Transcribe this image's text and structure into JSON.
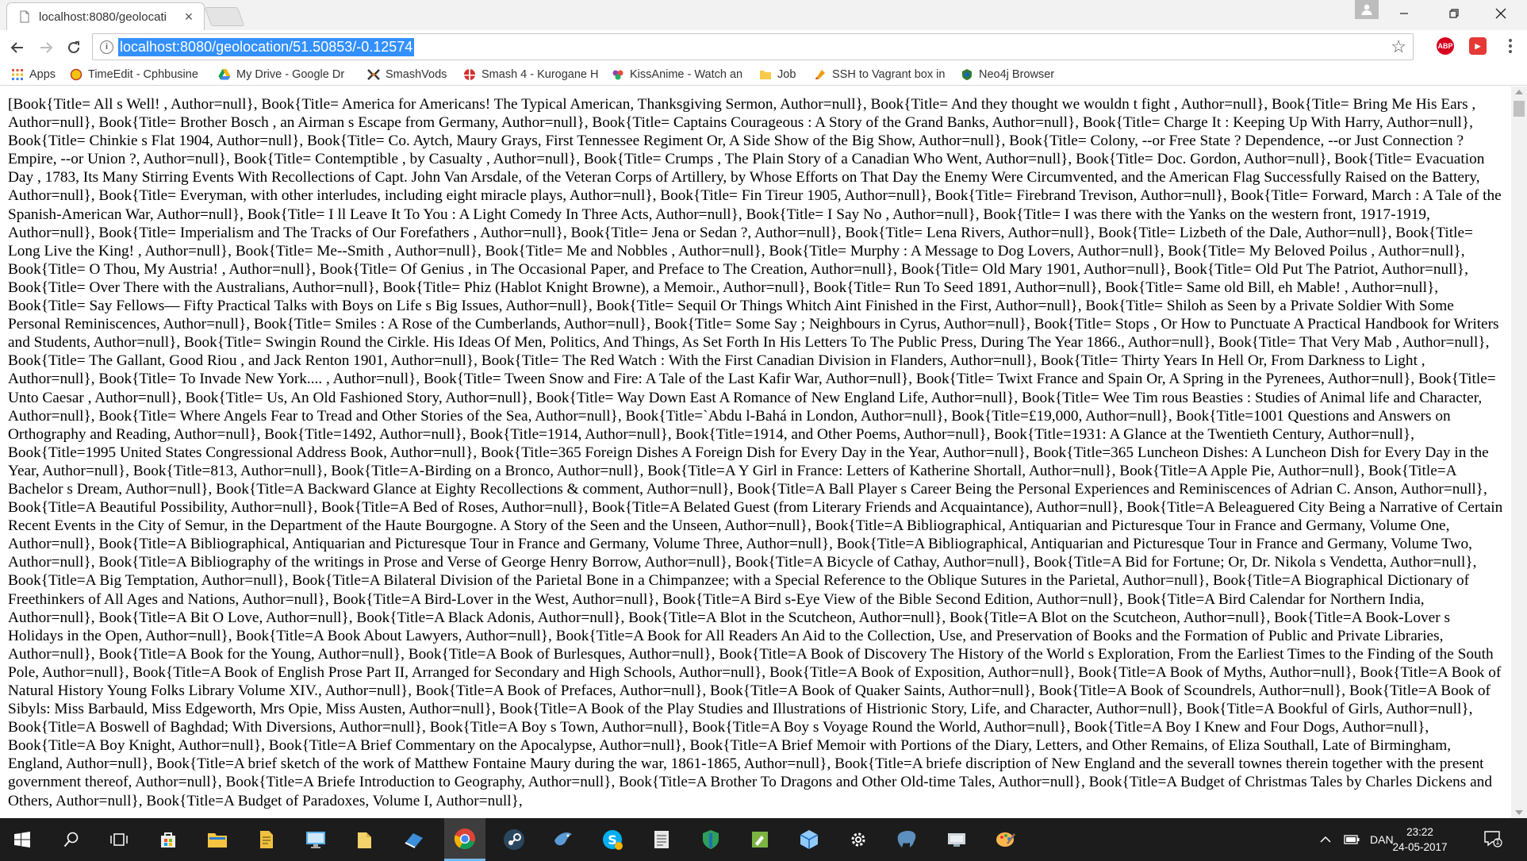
{
  "browser": {
    "tab_title": "localhost:8080/geolocati",
    "tab_close": "×",
    "url": "localhost:8080/geolocation/51.50853/-0.12574",
    "info_glyph": "i",
    "star_glyph": "☆"
  },
  "extensions": [
    {
      "name": "adblock-plus-icon",
      "label": "ABP",
      "color": "#d8001e"
    },
    {
      "name": "youtube-extension-icon",
      "label": "▶",
      "color": "#e53935"
    }
  ],
  "bookmarks": [
    {
      "label": "Apps",
      "icon": "apps-grid-icon"
    },
    {
      "label": "TimeEdit - Cphbusine",
      "icon": "timeedit-icon"
    },
    {
      "label": "My Drive - Google Dr",
      "icon": "google-drive-icon"
    },
    {
      "label": "SmashVods",
      "icon": "smashvods-icon"
    },
    {
      "label": "Smash 4 - Kurogane H",
      "icon": "smash-icon"
    },
    {
      "label": "KissAnime - Watch an",
      "icon": "kissanime-icon"
    },
    {
      "label": "Job",
      "icon": "folder-icon"
    },
    {
      "label": "SSH to Vagrant box in",
      "icon": "ssh-icon"
    },
    {
      "label": "Neo4j Browser",
      "icon": "neo4j-icon"
    }
  ],
  "page": {
    "response_text": "[Book{Title= All s Well! , Author=null}, Book{Title= America for Americans! The Typical American, Thanksgiving Sermon, Author=null}, Book{Title= And they thought we wouldn t fight , Author=null}, Book{Title= Bring Me His Ears , Author=null}, Book{Title= Brother Bosch , an Airman s Escape from Germany, Author=null}, Book{Title= Captains Courageous : A Story of the Grand Banks, Author=null}, Book{Title= Charge It : Keeping Up With Harry, Author=null}, Book{Title= Chinkie s Flat 1904, Author=null}, Book{Title= Co. Aytch, Maury Grays, First Tennessee Regiment Or, A Side Show of the Big Show, Author=null}, Book{Title= Colony, --or Free State ? Dependence, --or Just Connection ? Empire, --or Union ?, Author=null}, Book{Title= Contemptible , by Casualty , Author=null}, Book{Title= Crumps , The Plain Story of a Canadian Who Went, Author=null}, Book{Title= Doc. Gordon, Author=null}, Book{Title= Evacuation Day , 1783, Its Many Stirring Events With Recollections of Capt. John Van Arsdale, of the Veteran Corps of Artillery, by Whose Efforts on That Day the Enemy Were Circumvented, and the American Flag Successfully Raised on the Battery, Author=null}, Book{Title= Everyman, with other interludes, including eight miracle plays, Author=null}, Book{Title= Fin Tireur 1905, Author=null}, Book{Title= Firebrand Trevison, Author=null}, Book{Title= Forward, March : A Tale of the Spanish-American War, Author=null}, Book{Title= I ll Leave It To You : A Light Comedy In Three Acts, Author=null}, Book{Title= I Say No , Author=null}, Book{Title= I was there with the Yanks on the western front, 1917-1919, Author=null}, Book{Title= Imperialism and The Tracks of Our Forefathers , Author=null}, Book{Title= Jena or Sedan ?, Author=null}, Book{Title= Lena Rivers, Author=null}, Book{Title= Lizbeth of the Dale, Author=null}, Book{Title= Long Live the King! , Author=null}, Book{Title= Me--Smith , Author=null}, Book{Title= Me and Nobbles , Author=null}, Book{Title= Murphy : A Message to Dog Lovers, Author=null}, Book{Title= My Beloved Poilus , Author=null}, Book{Title= O Thou, My Austria! , Author=null}, Book{Title= Of Genius , in The Occasional Paper, and Preface to The Creation, Author=null}, Book{Title= Old Mary 1901, Author=null}, Book{Title= Old Put The Patriot, Author=null}, Book{Title= Over There with the Australians, Author=null}, Book{Title= Phiz (Hablot Knight Browne), a Memoir., Author=null}, Book{Title= Run To Seed 1891, Author=null}, Book{Title= Same old Bill, eh Mable! , Author=null}, Book{Title= Say Fellows— Fifty Practical Talks with Boys on Life s Big Issues, Author=null}, Book{Title= Sequil Or Things Whitch Aint Finished in the First, Author=null}, Book{Title= Shiloh as Seen by a Private Soldier With Some Personal Reminiscences, Author=null}, Book{Title= Smiles : A Rose of the Cumberlands, Author=null}, Book{Title= Some Say ; Neighbours in Cyrus, Author=null}, Book{Title= Stops , Or How to Punctuate A Practical Handbook for Writers and Students, Author=null}, Book{Title= Swingin Round the Cirkle. His Ideas Of Men, Politics, And Things, As Set Forth In His Letters To The Public Press, During The Year 1866., Author=null}, Book{Title= That Very Mab , Author=null}, Book{Title= The Gallant, Good Riou , and Jack Renton 1901, Author=null}, Book{Title= The Red Watch : With the First Canadian Division in Flanders, Author=null}, Book{Title= Thirty Years In Hell Or, From Darkness to Light , Author=null}, Book{Title= To Invade New York.... , Author=null}, Book{Title= Tween Snow and Fire: A Tale of the Last Kafir War, Author=null}, Book{Title= Twixt France and Spain Or, A Spring in the Pyrenees, Author=null}, Book{Title= Unto Caesar , Author=null}, Book{Title= Us, An Old Fashioned Story, Author=null}, Book{Title= Way Down East A Romance of New England Life, Author=null}, Book{Title= Wee Tim rous Beasties : Studies of Animal life and Character, Author=null}, Book{Title= Where Angels Fear to Tread and Other Stories of the Sea, Author=null}, Book{Title=`Abdu l-Bahá in London, Author=null}, Book{Title=£19,000, Author=null}, Book{Title=1001 Questions and Answers on Orthography and Reading, Author=null}, Book{Title=1492, Author=null}, Book{Title=1914, Author=null}, Book{Title=1914, and Other Poems, Author=null}, Book{Title=1931: A Glance at the Twentieth Century, Author=null}, Book{Title=1995 United States Congressional Address Book, Author=null}, Book{Title=365 Foreign Dishes A Foreign Dish for Every Day in the Year, Author=null}, Book{Title=365 Luncheon Dishes: A Luncheon Dish for Every Day in the Year, Author=null}, Book{Title=813, Author=null}, Book{Title=A-Birding on a Bronco, Author=null}, Book{Title=A Y Girl in France: Letters of Katherine Shortall, Author=null}, Book{Title=A Apple Pie, Author=null}, Book{Title=A Bachelor s Dream, Author=null}, Book{Title=A Backward Glance at Eighty Recollections & comment, Author=null}, Book{Title=A Ball Player s Career Being the Personal Experiences and Reminiscences of Adrian C. Anson, Author=null}, Book{Title=A Beautiful Possibility, Author=null}, Book{Title=A Bed of Roses, Author=null}, Book{Title=A Belated Guest (from Literary Friends and Acquaintance), Author=null}, Book{Title=A Beleaguered City Being a Narrative of Certain Recent Events in the City of Semur, in the Department of the Haute Bourgogne. A Story of the Seen and the Unseen, Author=null}, Book{Title=A Bibliographical, Antiquarian and Picturesque Tour in France and Germany, Volume One, Author=null}, Book{Title=A Bibliographical, Antiquarian and Picturesque Tour in France and Germany, Volume Three, Author=null}, Book{Title=A Bibliographical, Antiquarian and Picturesque Tour in France and Germany, Volume Two, Author=null}, Book{Title=A Bibliography of the writings in Prose and Verse of George Henry Borrow, Author=null}, Book{Title=A Bicycle of Cathay, Author=null}, Book{Title=A Bid for Fortune; Or, Dr. Nikola s Vendetta, Author=null}, Book{Title=A Big Temptation, Author=null}, Book{Title=A Bilateral Division of the Parietal Bone in a Chimpanzee; with a Special Reference to the Oblique Sutures in the Parietal, Author=null}, Book{Title=A Biographical Dictionary of Freethinkers of All Ages and Nations, Author=null}, Book{Title=A Bird-Lover in the West, Author=null}, Book{Title=A Bird s-Eye View of the Bible Second Edition, Author=null}, Book{Title=A Bird Calendar for Northern India, Author=null}, Book{Title=A Bit O Love, Author=null}, Book{Title=A Black Adonis, Author=null}, Book{Title=A Blot in the Scutcheon, Author=null}, Book{Title=A Blot on the Scutcheon, Author=null}, Book{Title=A Book-Lover s Holidays in the Open, Author=null}, Book{Title=A Book About Lawyers, Author=null}, Book{Title=A Book for All Readers An Aid to the Collection, Use, and Preservation of Books and the Formation of Public and Private Libraries, Author=null}, Book{Title=A Book for the Young, Author=null}, Book{Title=A Book of Burlesques, Author=null}, Book{Title=A Book of Discovery The History of the World s Exploration, From the Earliest Times to the Finding of the South Pole, Author=null}, Book{Title=A Book of English Prose Part II, Arranged for Secondary and High Schools, Author=null}, Book{Title=A Book of Exposition, Author=null}, Book{Title=A Book of Myths, Author=null}, Book{Title=A Book of Natural History Young Folks Library Volume XIV., Author=null}, Book{Title=A Book of Prefaces, Author=null}, Book{Title=A Book of Quaker Saints, Author=null}, Book{Title=A Book of Scoundrels, Author=null}, Book{Title=A Book of Sibyls: Miss Barbauld, Miss Edgeworth, Mrs Opie, Miss Austen, Author=null}, Book{Title=A Book of the Play Studies and Illustrations of Histrionic Story, Life, and Character, Author=null}, Book{Title=A Bookful of Girls, Author=null}, Book{Title=A Boswell of Baghdad; With Diversions, Author=null}, Book{Title=A Boy s Town, Author=null}, Book{Title=A Boy s Voyage Round the World, Author=null}, Book{Title=A Boy I Knew and Four Dogs, Author=null}, Book{Title=A Boy Knight, Author=null}, Book{Title=A Brief Commentary on the Apocalypse, Author=null}, Book{Title=A Brief Memoir with Portions of the Diary, Letters, and Other Remains, of Eliza Southall, Late of Birmingham, England, Author=null}, Book{Title=A brief sketch of the work of Matthew Fontaine Maury during the war, 1861-1865, Author=null}, Book{Title=A briefe discription of New England and the severall townes therein together with the present government thereof, Author=null}, Book{Title=A Briefe Introduction to Geography, Author=null}, Book{Title=A Brother To Dragons and Other Old-time Tales, Author=null}, Book{Title=A Budget of Christmas Tales by Charles Dickens and Others, Author=null}, Book{Title=A Budget of Paradoxes, Volume I, Author=null},"
  },
  "taskbar": {
    "items": [
      {
        "name": "taskbar-search",
        "color": "#1c1c1c"
      },
      {
        "name": "taskbar-task-view",
        "color": "#1c1c1c"
      },
      {
        "name": "taskbar-store",
        "color": "#eeeeee"
      },
      {
        "name": "taskbar-file-explorer",
        "color": "#f5c542"
      },
      {
        "name": "taskbar-docs",
        "color": "#f0c040"
      },
      {
        "name": "taskbar-remote-desktop",
        "color": "#5ab0e8"
      },
      {
        "name": "taskbar-folder",
        "color": "#f3d26b"
      },
      {
        "name": "taskbar-app-blue",
        "color": "#3c8fd8"
      },
      {
        "name": "taskbar-chrome",
        "color": "#4caf50"
      },
      {
        "name": "taskbar-steam",
        "color": "#2a475e"
      },
      {
        "name": "taskbar-app-bird",
        "color": "#5b9bd5"
      },
      {
        "name": "taskbar-skype",
        "color": "#00aff0"
      },
      {
        "name": "taskbar-document",
        "color": "#e8e8e8"
      },
      {
        "name": "taskbar-shield",
        "color": "#2e9e5b"
      },
      {
        "name": "taskbar-notepad-green",
        "color": "#7cb342"
      },
      {
        "name": "taskbar-virtualbox",
        "color": "#90caf9"
      },
      {
        "name": "taskbar-settings",
        "color": "#1c1c1c"
      },
      {
        "name": "taskbar-postgres",
        "color": "#5d8fbf"
      },
      {
        "name": "taskbar-app-monitor",
        "color": "#cfd8dc"
      },
      {
        "name": "taskbar-paint",
        "color": "#ffb74d"
      }
    ],
    "language": "DAN",
    "time": "23:22",
    "date": "24-05-2017",
    "notification_count": "1"
  }
}
